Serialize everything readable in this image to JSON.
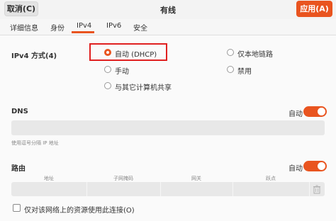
{
  "header": {
    "cancel_label": "取消(C)",
    "title": "有线",
    "apply_label": "应用(A)"
  },
  "tabs": [
    {
      "label": "详细信息",
      "active": false
    },
    {
      "label": "身份",
      "active": false
    },
    {
      "label": "IPv4",
      "active": true
    },
    {
      "label": "IPv6",
      "active": false
    },
    {
      "label": "安全",
      "active": false
    }
  ],
  "ipv4": {
    "method_label": "IPv4 方式(4)",
    "methods": [
      {
        "label": "自动 (DHCP)",
        "checked": true
      },
      {
        "label": "手动",
        "checked": false
      },
      {
        "label": "与其它计算机共享",
        "checked": false
      },
      {
        "label": "仅本地链路",
        "checked": false
      },
      {
        "label": "禁用",
        "checked": false
      }
    ]
  },
  "dns": {
    "label": "DNS",
    "auto_label": "自动",
    "auto_enabled": true,
    "value": "",
    "hint": "使用逗号分隔 IP 地址"
  },
  "routes": {
    "label": "路由",
    "auto_label": "自动",
    "auto_enabled": true,
    "columns": [
      "地址",
      "子网掩码",
      "网关",
      "跃点"
    ]
  },
  "only_local_resources": {
    "label": "仅对该网络上的资源使用此连接(O)",
    "checked": false
  },
  "colors": {
    "accent": "#e9541f",
    "highlight": "#e02020"
  }
}
